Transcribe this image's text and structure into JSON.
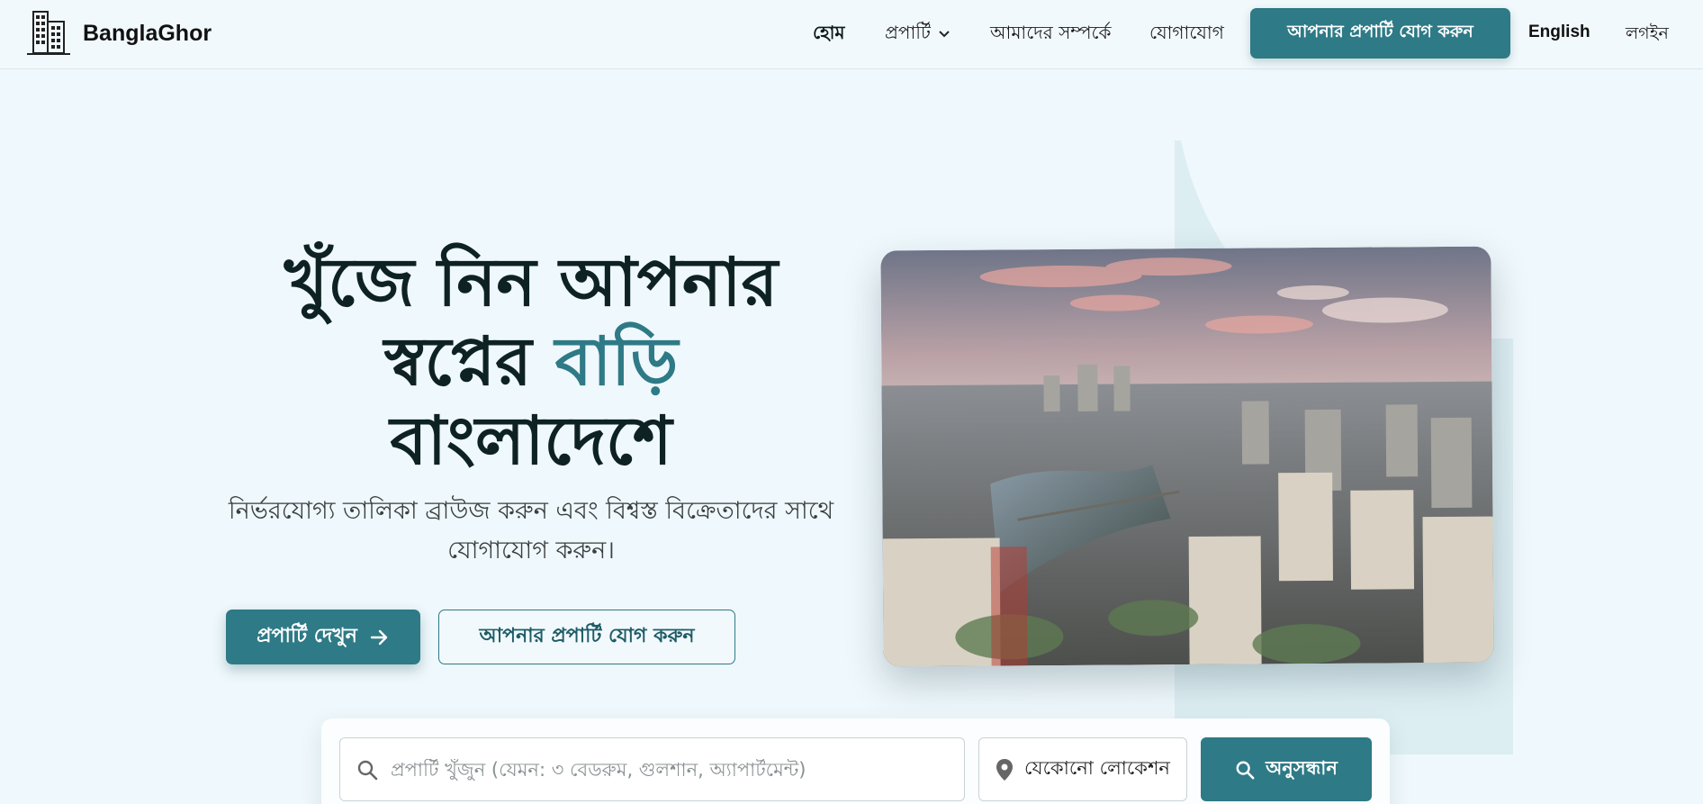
{
  "brand": {
    "name": "BanglaGhor",
    "logo_icon": "building-icon"
  },
  "nav": {
    "home": "হোম",
    "property": "প্রপার্টি",
    "about": "আমাদের সম্পর্কে",
    "contact": "যোগাযোগ",
    "add_property_cta": "আপনার প্রপার্টি যোগ করুন",
    "language": "English",
    "login": "লগইন"
  },
  "hero": {
    "title_line1": "খুঁজে নিন আপনার",
    "title_line2_a": "স্বপ্নের ",
    "title_line2_accent": "বাড়ি",
    "title_line3": "বাংলাদেশে",
    "subtitle": "নির্ভরযোগ্য তালিকা ব্রাউজ করুন এবং বিশ্বস্ত বিক্রেতাদের সাথে যোগাযোগ করুন।",
    "primary_button": "প্রপার্টি দেখুন",
    "secondary_button": "আপনার প্রপার্টি যোগ করুন",
    "accent_color": "#2e7a86"
  },
  "search": {
    "placeholder": "প্রপার্টি খুঁজুন (যেমন: ৩ বেডরুম, গুলশান, অ্যাপার্টমেন্ট)",
    "location_value": "যেকোনো লোকেশন",
    "button_label": "অনুসন্ধান"
  }
}
